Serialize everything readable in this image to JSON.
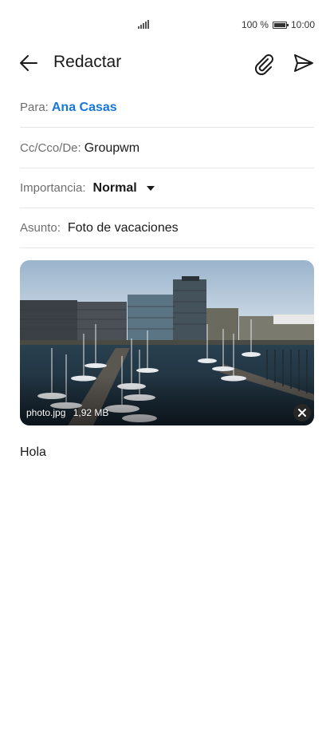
{
  "status_bar": {
    "battery_text": "100 %",
    "time": "10:00",
    "icons": [
      "signal-icon",
      "battery-icon"
    ]
  },
  "app_bar": {
    "title": "Redactar",
    "icons": [
      "back-arrow-icon",
      "paperclip-icon",
      "send-icon"
    ]
  },
  "form": {
    "to_label": "Para:",
    "to_value": "Ana Casas",
    "cc_label": "Cc/Cco/De:",
    "cc_value": "Groupwm",
    "importance_label": "Importancia:",
    "importance_value": "Normal",
    "subject_label": "Asunto:",
    "subject_value": "Foto de vacaciones"
  },
  "attachment": {
    "filename": "photo.jpg",
    "size": "1,92 MB",
    "icons": [
      "remove-icon"
    ]
  },
  "message_body": "Hola",
  "colors": {
    "link": "#1677d8",
    "label": "#6e6e6e",
    "divider": "#e6e6e6"
  }
}
